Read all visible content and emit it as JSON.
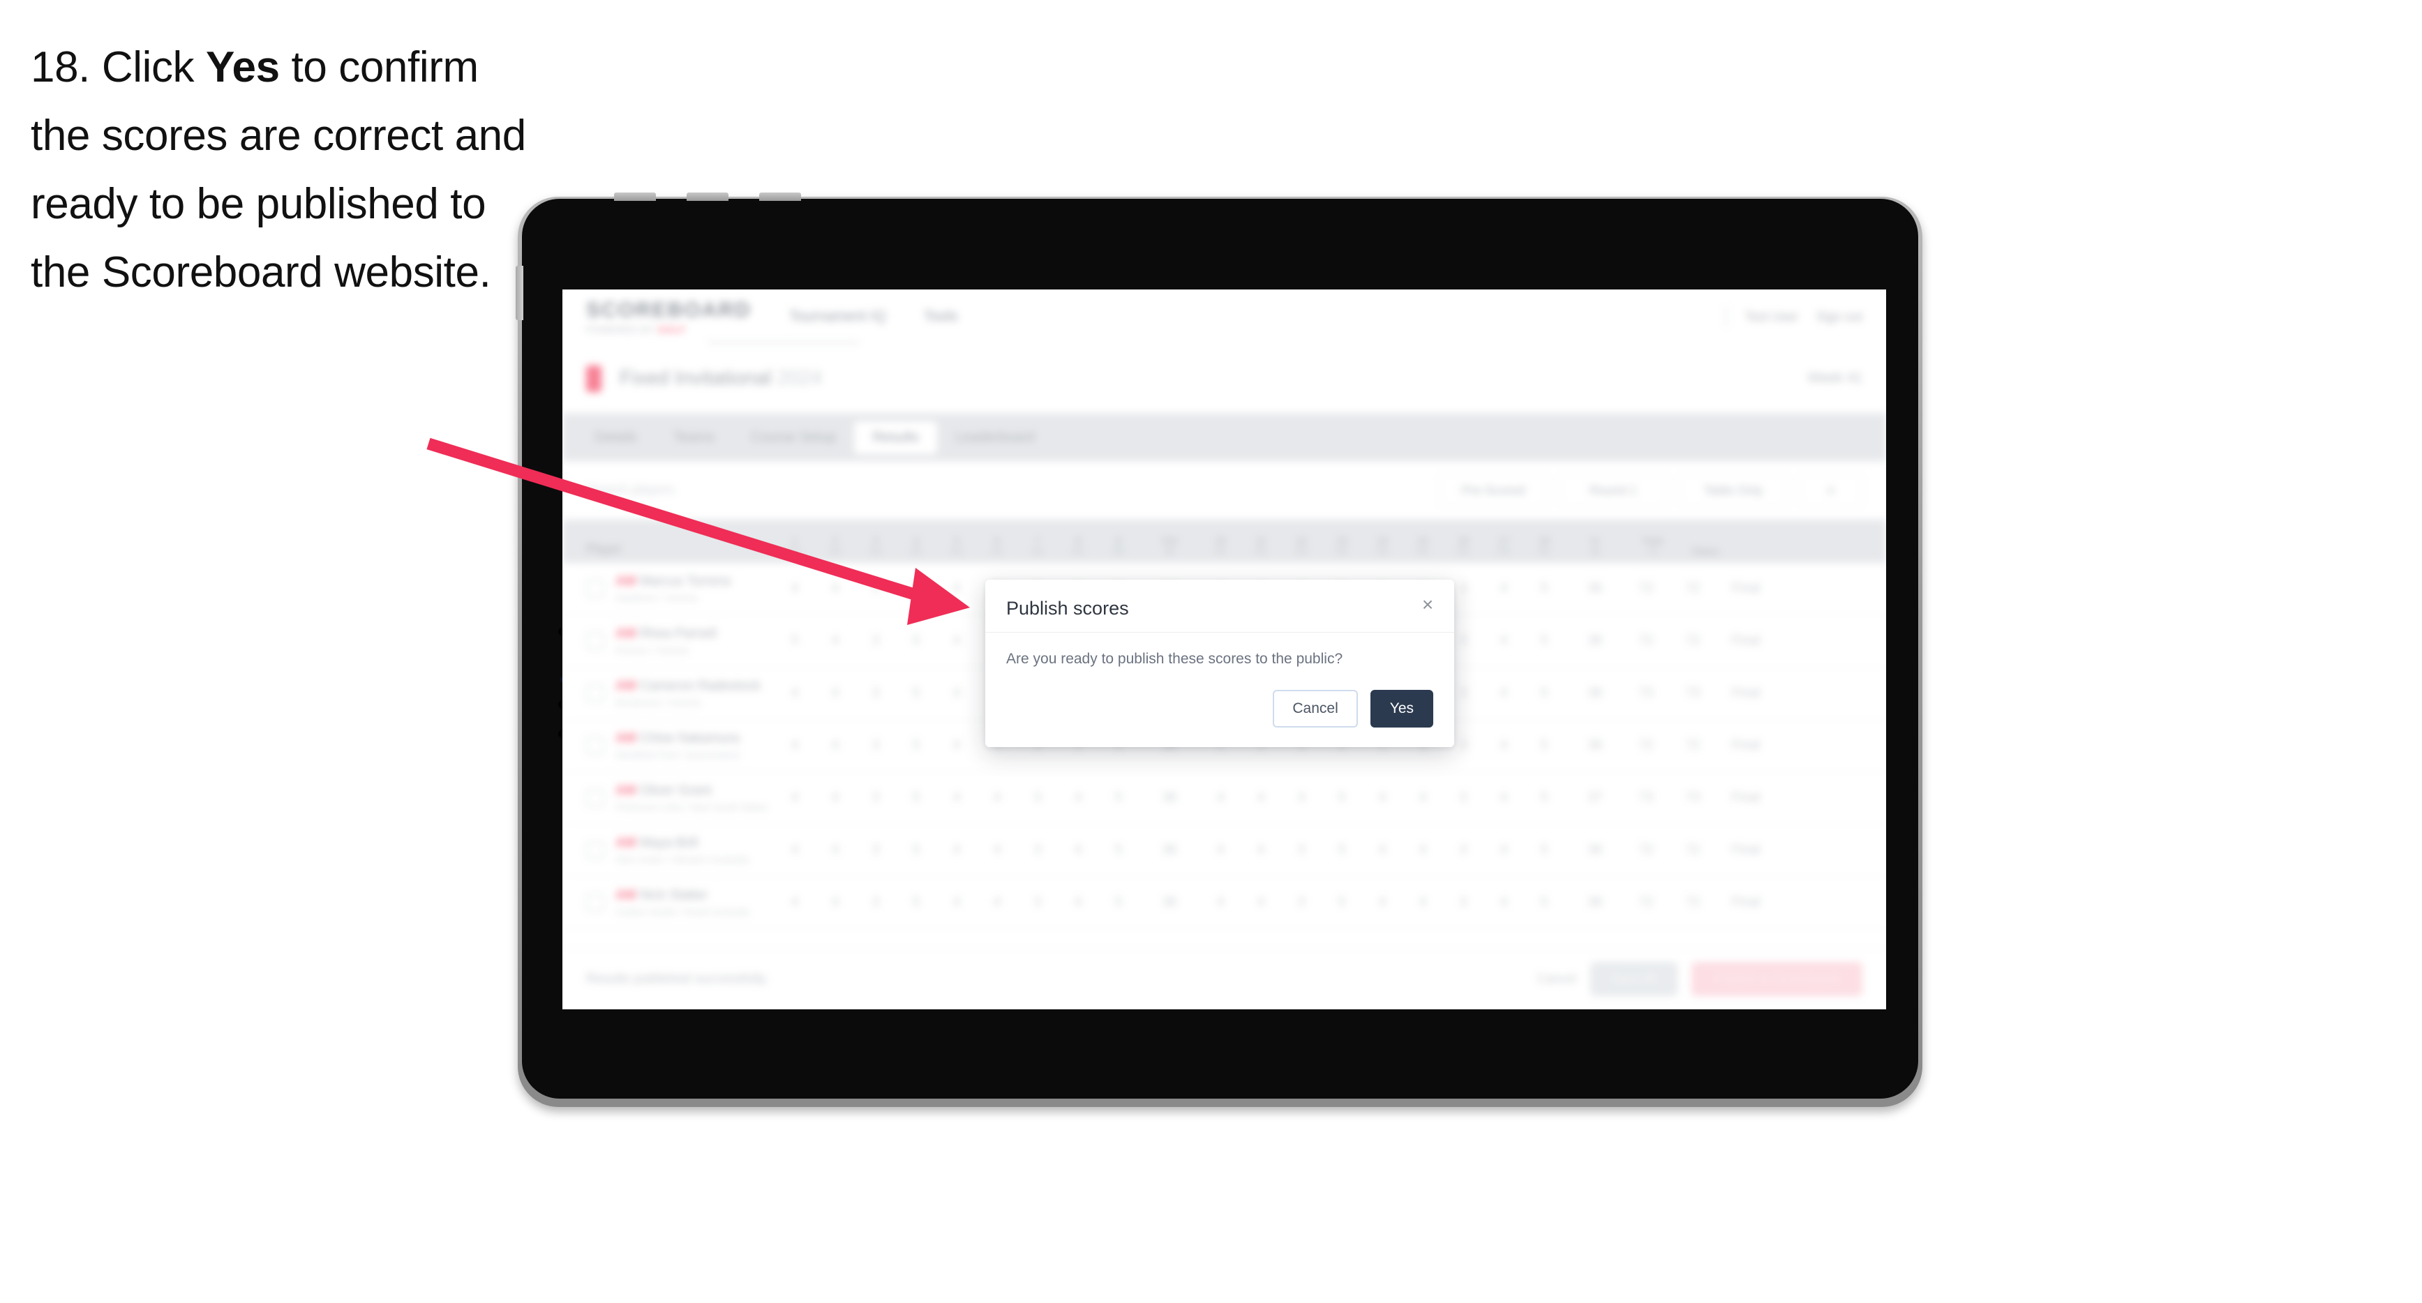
{
  "caption": {
    "step_number": "18.",
    "prefix": " Click ",
    "emphasis": "Yes",
    "suffix": " to confirm the scores are correct and ready to be published to the Scoreboard website."
  },
  "annotation": {
    "arrow_color": "#ef2d56",
    "points_to": "yes-button"
  },
  "device": {
    "type": "tablet"
  },
  "app": {
    "topbar": {
      "logo": "SCOREBOARD",
      "logo_sub": "POWERED BY",
      "logo_sub_accent": "GOLF",
      "nav": [
        {
          "label": "Tournament IQ"
        },
        {
          "label": "Tools"
        }
      ],
      "right": [
        {
          "label": "Test User"
        },
        {
          "label": "Sign out"
        }
      ]
    },
    "title_row": {
      "title": "Fixed Invitational",
      "year": "2024",
      "right_label": "Week 41"
    },
    "tabs": [
      {
        "label": "Details"
      },
      {
        "label": "Teams"
      },
      {
        "label": "Course Setup"
      },
      {
        "label": "Results"
      },
      {
        "label": "Leaderboard"
      }
    ],
    "active_tab": "Results",
    "filters": {
      "search_placeholder": "Search players",
      "buttons": [
        {
          "label": "Pre-Scored"
        },
        {
          "label": "Round 1"
        },
        {
          "label": "Table Only"
        },
        {
          "label": "≡"
        }
      ]
    },
    "table": {
      "columns": [
        {
          "label": "Player",
          "type": "player"
        },
        {
          "label": "1",
          "sub": "P4"
        },
        {
          "label": "2",
          "sub": "P4"
        },
        {
          "label": "3",
          "sub": "P3"
        },
        {
          "label": "4",
          "sub": "P5"
        },
        {
          "label": "5",
          "sub": "P4"
        },
        {
          "label": "6",
          "sub": "P4"
        },
        {
          "label": "7",
          "sub": "P3"
        },
        {
          "label": "8",
          "sub": "P4"
        },
        {
          "label": "9",
          "sub": "P5"
        },
        {
          "label": "Out",
          "sub": "36"
        },
        {
          "label": "10",
          "sub": "P4"
        },
        {
          "label": "11",
          "sub": "P4"
        },
        {
          "label": "12",
          "sub": "P3"
        },
        {
          "label": "13",
          "sub": "P5"
        },
        {
          "label": "14",
          "sub": "P4"
        },
        {
          "label": "15",
          "sub": "P4"
        },
        {
          "label": "16",
          "sub": "P3"
        },
        {
          "label": "17",
          "sub": "P4"
        },
        {
          "label": "18",
          "sub": "P5"
        },
        {
          "label": "In",
          "sub": "36"
        },
        {
          "label": "Total",
          "sub": "72"
        },
        {
          "label": "Status",
          "sub": ""
        }
      ],
      "rows": [
        {
          "tag": "AM",
          "name": "Marcus Torrens",
          "sub": "Hawthorn / Victoria",
          "scores": [
            "4",
            "4",
            "3",
            "5",
            "4",
            "4",
            "3",
            "4",
            "5",
            "36",
            "4",
            "4",
            "3",
            "5",
            "4",
            "4",
            "3",
            "4",
            "5",
            "36",
            "72"
          ],
          "total": "72",
          "status": "Final"
        },
        {
          "tag": "AM",
          "name": "Rhea Parnell",
          "sub": "Kinross / Victoria",
          "scores": [
            "5",
            "4",
            "3",
            "5",
            "4",
            "4",
            "3",
            "4",
            "4",
            "36",
            "4",
            "4",
            "3",
            "5",
            "4",
            "4",
            "3",
            "4",
            "5",
            "36",
            "72"
          ],
          "total": "72",
          "status": "Final"
        },
        {
          "tag": "AM",
          "name": "Cameron Radestock",
          "sub": "Brookview / Victoria",
          "scores": [
            "4",
            "4",
            "3",
            "5",
            "4",
            "5",
            "3",
            "4",
            "5",
            "37",
            "4",
            "4",
            "3",
            "5",
            "4",
            "4",
            "3",
            "4",
            "5",
            "36",
            "73"
          ],
          "total": "73",
          "status": "Final"
        },
        {
          "tag": "AM",
          "name": "Chloe Nakamura",
          "sub": "Westfield Park / Queensland",
          "scores": [
            "4",
            "4",
            "3",
            "5",
            "4",
            "4",
            "3",
            "4",
            "5",
            "36",
            "4",
            "4",
            "3",
            "5",
            "4",
            "4",
            "3",
            "4",
            "5",
            "36",
            "72"
          ],
          "total": "72",
          "status": "Final"
        },
        {
          "tag": "AM",
          "name": "Oliver Grant",
          "sub": "Pinehurst Links / New South Wales",
          "scores": [
            "4",
            "4",
            "3",
            "5",
            "4",
            "4",
            "3",
            "4",
            "5",
            "36",
            "4",
            "4",
            "4",
            "5",
            "4",
            "4",
            "3",
            "4",
            "5",
            "37",
            "73"
          ],
          "total": "73",
          "status": "Final"
        },
        {
          "tag": "AM",
          "name": "Maya Brill",
          "sub": "Glen Arden / Western Australia",
          "scores": [
            "4",
            "4",
            "3",
            "5",
            "4",
            "4",
            "3",
            "4",
            "5",
            "36",
            "4",
            "4",
            "3",
            "5",
            "4",
            "4",
            "3",
            "4",
            "5",
            "36",
            "72"
          ],
          "total": "72",
          "status": "Final"
        },
        {
          "tag": "AM",
          "name": "Nick Slatter",
          "sub": "Carlton Heath / South Australia",
          "scores": [
            "4",
            "4",
            "3",
            "5",
            "4",
            "4",
            "3",
            "4",
            "5",
            "36",
            "4",
            "4",
            "3",
            "5",
            "4",
            "4",
            "3",
            "4",
            "5",
            "36",
            "72"
          ],
          "total": "72",
          "status": "Final"
        }
      ]
    },
    "footer": {
      "note": "Results published successfully.",
      "cancel_link": "Cancel",
      "save_label": "Save All",
      "publish_label": "Publish to Scoreboard"
    }
  },
  "dialog": {
    "title": "Publish scores",
    "message": "Are you ready to publish these scores to the public?",
    "close_icon": "×",
    "cancel_label": "Cancel",
    "confirm_label": "Yes",
    "confirm_color": "#2b3a4f"
  }
}
